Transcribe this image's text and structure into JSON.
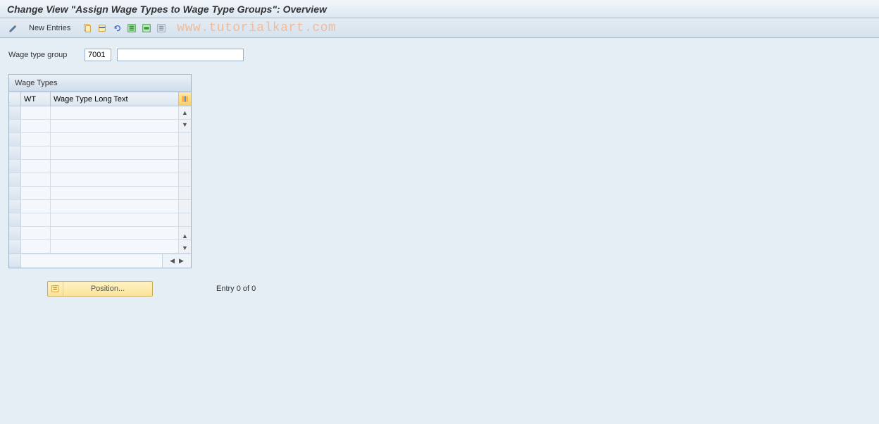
{
  "title": "Change View \"Assign Wage Types to Wage Type Groups\": Overview",
  "toolbar": {
    "new_entries": "New Entries"
  },
  "watermark_url": "www.tutorialkart.com",
  "form": {
    "wage_type_group_label": "Wage type group",
    "wage_type_group_value": "7001",
    "wage_type_group_desc": ""
  },
  "grid": {
    "title": "Wage Types",
    "col_wt": "WT",
    "col_long": "Wage Type Long Text",
    "row_count": 11
  },
  "position_button": "Position...",
  "entry_status": "Entry 0 of 0",
  "icons": {
    "pencil": "pencil-icon",
    "copy": "copy-icon",
    "save": "save-icon",
    "undo": "undo-icon",
    "delete": "delete-icon",
    "select_all": "select-all-icon",
    "deselect": "deselect-all-icon",
    "config": "config-icon",
    "position": "position-icon",
    "up": "▲",
    "down": "▼",
    "left": "◀",
    "right": "▶"
  }
}
